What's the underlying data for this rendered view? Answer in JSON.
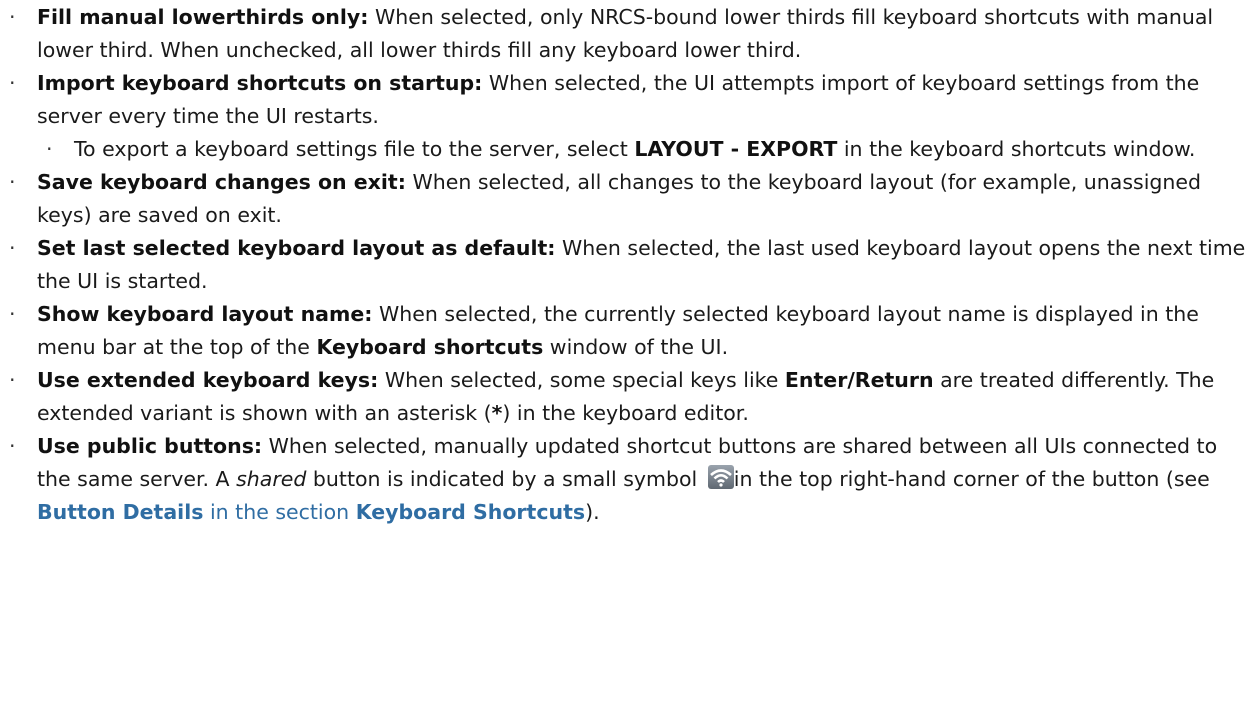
{
  "bullet_char": "·",
  "items": [
    {
      "term": "Fill manual lowerthirds only:",
      "text": " When selected, only NRCS-bound lower thirds fill keyboard shortcuts with manual lower third. When unchecked, all lower thirds fill any keyboard lower third."
    },
    {
      "term": "Import keyboard shortcuts on startup:",
      "text": " When selected, the UI attempts import of keyboard settings from the server every time the UI restarts.",
      "sub": {
        "pre": "To export a keyboard settings file to the server, select ",
        "bold": "LAYOUT - EXPORT",
        "post": " in the keyboard shortcuts window."
      }
    },
    {
      "term": "Save keyboard changes on exit:",
      "text": " When selected, all changes to the keyboard layout (for example, unassigned keys) are saved on exit."
    },
    {
      "term": "Set last selected keyboard layout as default:",
      "text": " When selected, the last used keyboard layout opens the next time the UI is started."
    },
    {
      "term": "Show keyboard layout name:",
      "text_pre": " When selected, the currently selected keyboard layout name is displayed in the menu bar at the top of the ",
      "bold": "Keyboard shortcuts",
      "text_post": " window of the UI."
    },
    {
      "term": "Use extended keyboard keys:",
      "text_pre": " When selected, some special keys like ",
      "bold": "Enter/Return",
      "text_mid": " are treated differently. The extended variant is shown with an asterisk (",
      "bold2": "*",
      "text_post": ") in the keyboard editor."
    },
    {
      "term": "Use public buttons:",
      "text_pre": " When selected, manually updated shortcut buttons are shared between all UIs connected to the same server. A ",
      "italic": "shared",
      "text_mid": " button is indicated by a small symbol ",
      "icon": "wifi-broadcast-icon",
      "text_mid2": "in the top right-hand corner of the button (see ",
      "link1": "Button Details",
      "link_between": " in the section ",
      "link2": "Keyboard Shortcuts",
      "text_post": ")."
    }
  ]
}
